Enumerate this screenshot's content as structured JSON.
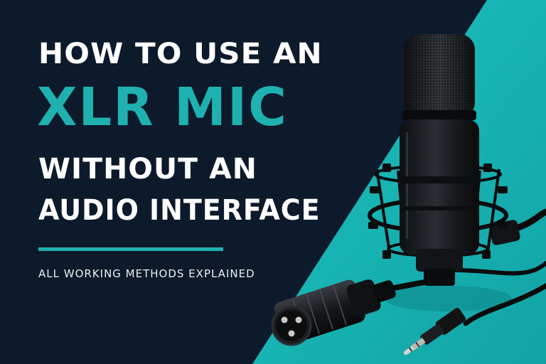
{
  "headline": {
    "line1": "HOW TO USE AN",
    "line2": "XLR MIC",
    "line3": "WITHOUT AN",
    "line4": "AUDIO INTERFACE"
  },
  "subtitle": "ALL WORKING METHODS EXPLAINED",
  "colors": {
    "background_dark": "#0c1a2b",
    "accent_teal": "#1fb1b0",
    "text_white": "#ffffff"
  },
  "icons": [
    "microphone-icon",
    "xlr-connector-icon",
    "aux-jack-icon"
  ]
}
